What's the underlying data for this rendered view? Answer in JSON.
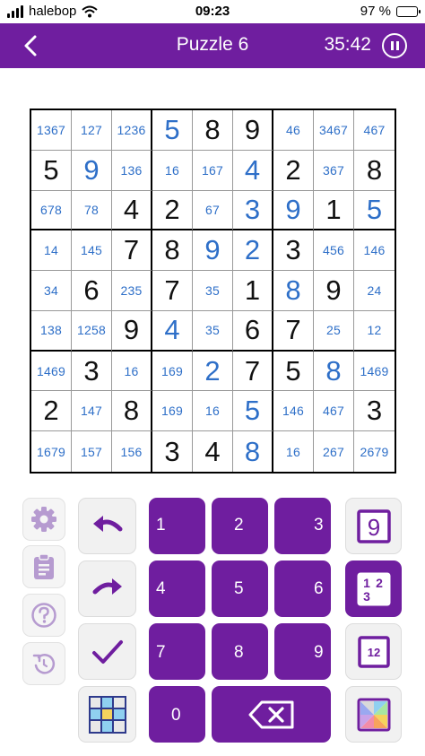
{
  "status_bar": {
    "carrier": "halebop",
    "time": "09:23",
    "battery": "97 %",
    "battery_level": 0.97
  },
  "header": {
    "title": "Puzzle 6",
    "timer": "35:42"
  },
  "grid": [
    [
      {
        "c": "1367"
      },
      {
        "c": "127"
      },
      {
        "c": "1236"
      },
      {
        "e": "5"
      },
      {
        "g": "8"
      },
      {
        "g": "9"
      },
      {
        "c": "46"
      },
      {
        "c": "3467"
      },
      {
        "c": "467"
      }
    ],
    [
      {
        "g": "5"
      },
      {
        "e": "9"
      },
      {
        "c": "136"
      },
      {
        "c": "16"
      },
      {
        "c": "167"
      },
      {
        "e": "4"
      },
      {
        "g": "2"
      },
      {
        "c": "367"
      },
      {
        "g": "8"
      }
    ],
    [
      {
        "c": "678"
      },
      {
        "c": "78"
      },
      {
        "g": "4"
      },
      {
        "g": "2"
      },
      {
        "c": "67"
      },
      {
        "e": "3"
      },
      {
        "e": "9"
      },
      {
        "g": "1"
      },
      {
        "e": "5"
      }
    ],
    [
      {
        "c": "14"
      },
      {
        "c": "145"
      },
      {
        "g": "7"
      },
      {
        "g": "8"
      },
      {
        "e": "9"
      },
      {
        "e": "2"
      },
      {
        "g": "3"
      },
      {
        "c": "456"
      },
      {
        "c": "146"
      }
    ],
    [
      {
        "c": "34"
      },
      {
        "g": "6"
      },
      {
        "c": "235"
      },
      {
        "g": "7"
      },
      {
        "c": "35"
      },
      {
        "g": "1"
      },
      {
        "e": "8"
      },
      {
        "g": "9"
      },
      {
        "c": "24"
      }
    ],
    [
      {
        "c": "138"
      },
      {
        "c": "1258"
      },
      {
        "g": "9"
      },
      {
        "e": "4"
      },
      {
        "c": "35"
      },
      {
        "g": "6"
      },
      {
        "g": "7"
      },
      {
        "c": "25"
      },
      {
        "c": "12"
      }
    ],
    [
      {
        "c": "1469"
      },
      {
        "g": "3"
      },
      {
        "c": "16"
      },
      {
        "c": "169"
      },
      {
        "e": "2"
      },
      {
        "g": "7"
      },
      {
        "g": "5"
      },
      {
        "e": "8"
      },
      {
        "c": "1469"
      }
    ],
    [
      {
        "g": "2"
      },
      {
        "c": "147"
      },
      {
        "g": "8"
      },
      {
        "c": "169"
      },
      {
        "c": "16"
      },
      {
        "e": "5"
      },
      {
        "c": "146"
      },
      {
        "c": "467"
      },
      {
        "g": "3"
      }
    ],
    [
      {
        "c": "1679"
      },
      {
        "c": "157"
      },
      {
        "c": "156"
      },
      {
        "g": "3"
      },
      {
        "g": "4"
      },
      {
        "e": "8"
      },
      {
        "c": "16"
      },
      {
        "c": "267"
      },
      {
        "c": "2679"
      }
    ]
  ],
  "keypad": {
    "keys": [
      "1",
      "2",
      "3",
      "4",
      "5",
      "6",
      "7",
      "8",
      "9",
      "0"
    ],
    "mode_normal_label": "9",
    "mode_candidate_labels": [
      "1",
      "2",
      "3"
    ],
    "mode_killer_label": "12"
  },
  "colors": {
    "accent": "#6f1e9f",
    "entered": "#2e6fc8",
    "given": "#111111",
    "side_icon": "#b69bd0"
  },
  "icons": [
    "back-chevron-icon",
    "pause-icon",
    "gear-icon",
    "clipboard-icon",
    "help-icon",
    "reset-icon",
    "undo-icon",
    "redo-icon",
    "check-icon",
    "grid-color-icon",
    "backspace-icon",
    "color-wheel-icon"
  ]
}
